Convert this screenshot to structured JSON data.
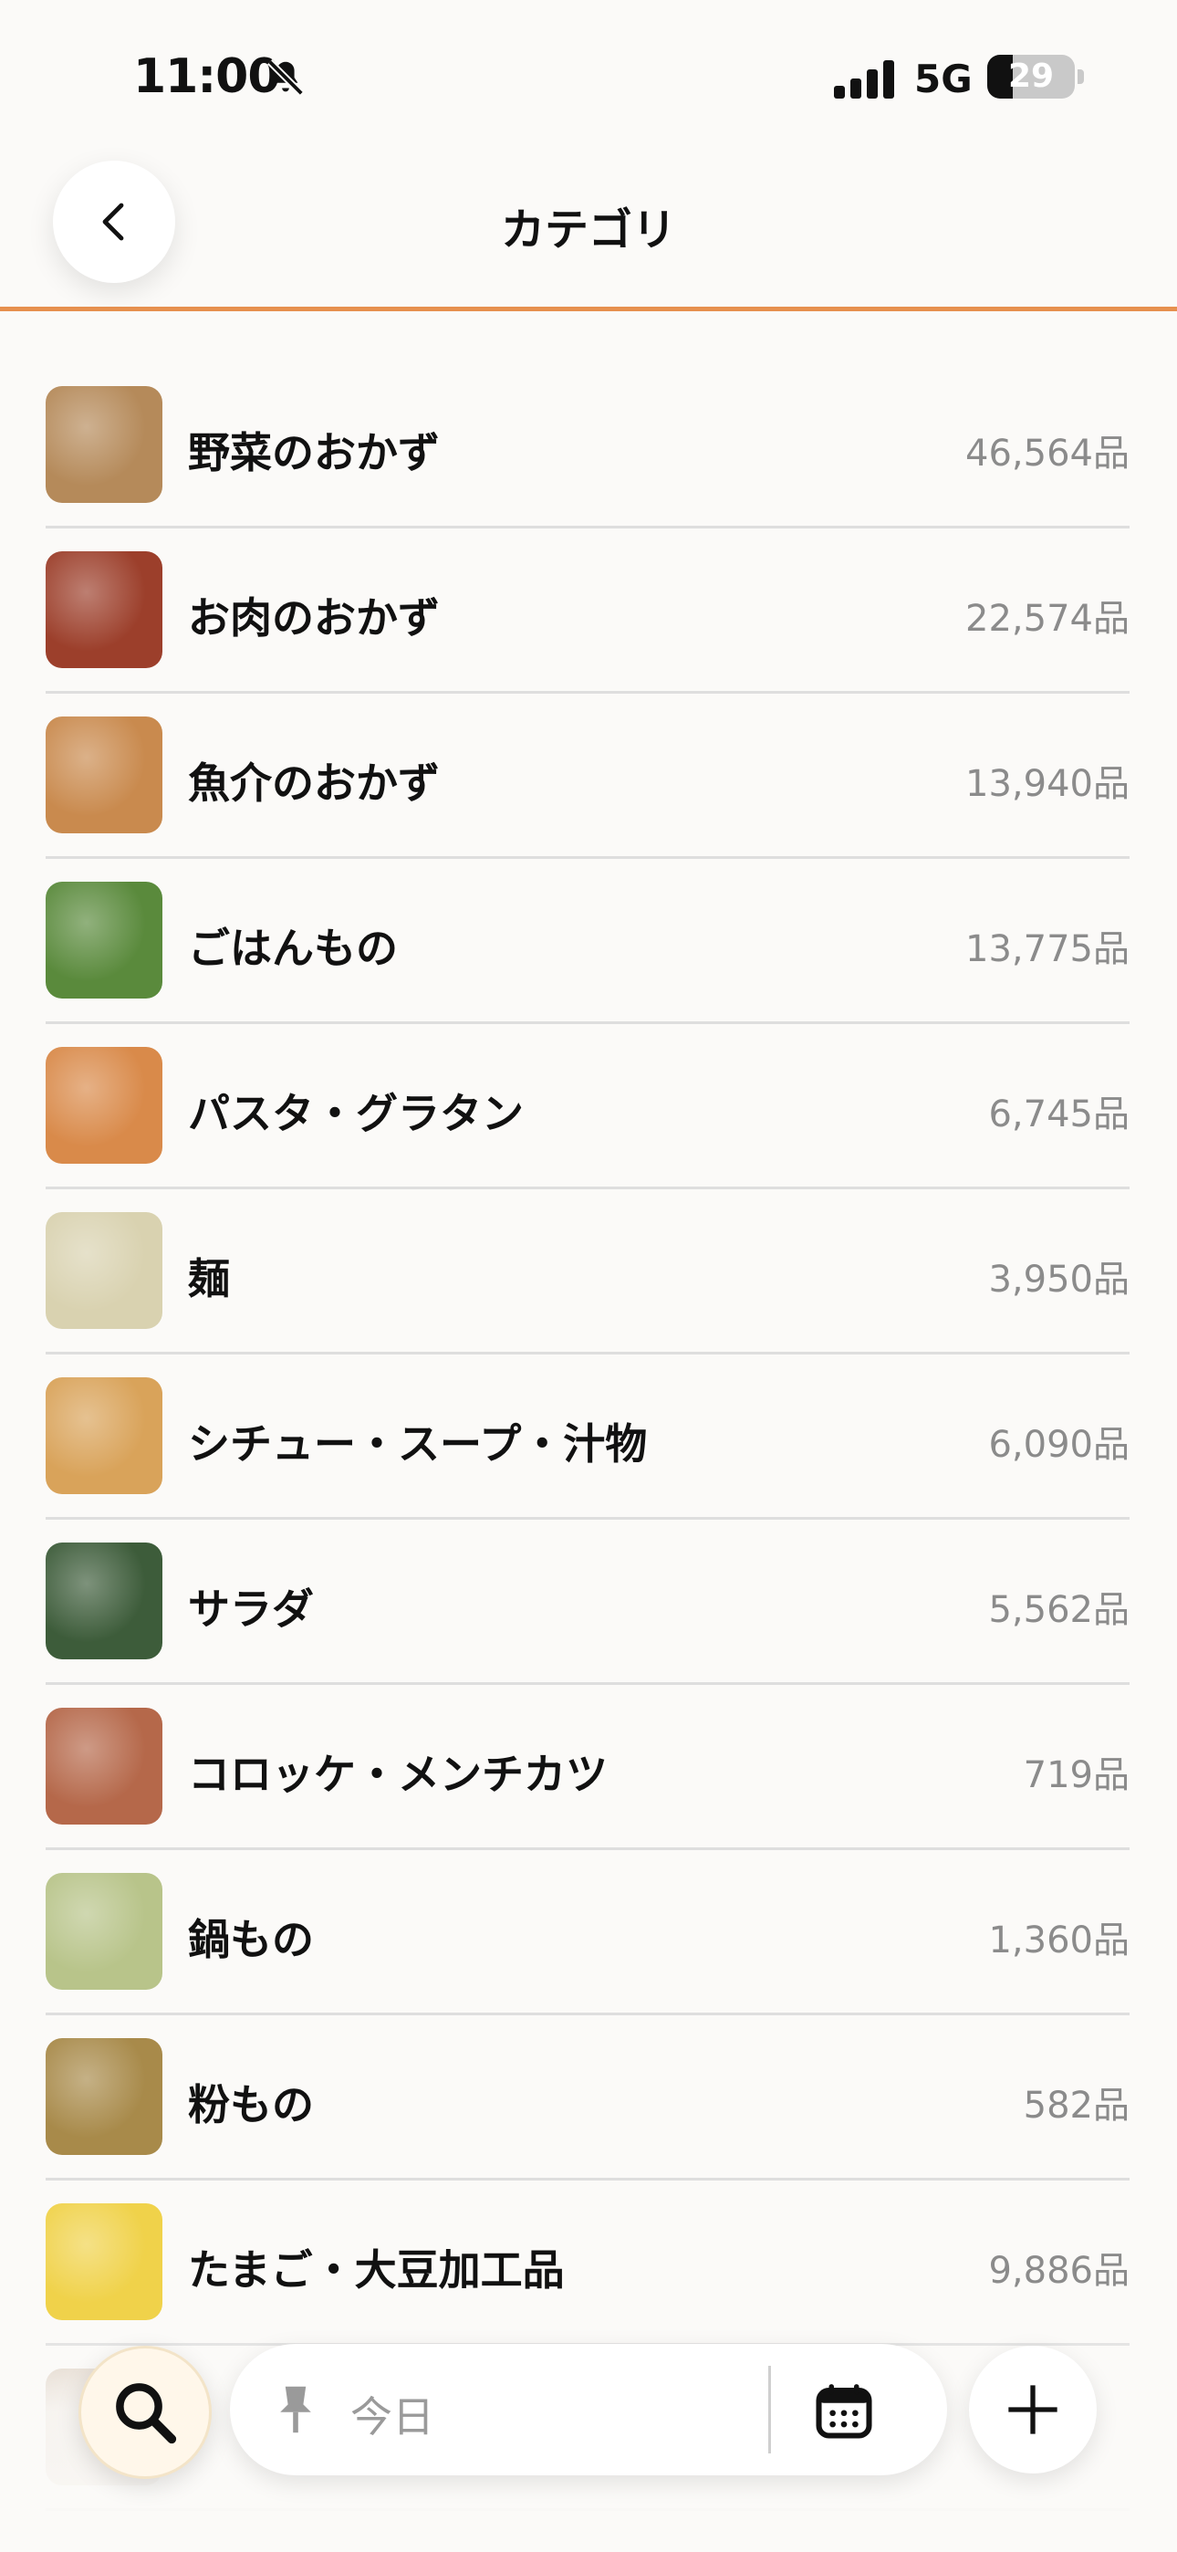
{
  "status_bar": {
    "time": "11:00",
    "network": "5G",
    "battery_level": "29",
    "battery_fraction": 0.29
  },
  "header": {
    "title": "カテゴリ"
  },
  "categories": [
    {
      "label": "野菜のおかず",
      "count": "46,564品",
      "thumb_color": "#b58a5a"
    },
    {
      "label": "お肉のおかず",
      "count": "22,574品",
      "thumb_color": "#9c3f2b"
    },
    {
      "label": "魚介のおかず",
      "count": "13,940品",
      "thumb_color": "#c98a4e"
    },
    {
      "label": "ごはんもの",
      "count": "13,775品",
      "thumb_color": "#5a8a3c"
    },
    {
      "label": "パスタ・グラタン",
      "count": "6,745品",
      "thumb_color": "#d98a4a"
    },
    {
      "label": "麺",
      "count": "3,950品",
      "thumb_color": "#d9d2b0"
    },
    {
      "label": "シチュー・スープ・汁物",
      "count": "6,090品",
      "thumb_color": "#d9a35a"
    },
    {
      "label": "サラダ",
      "count": "5,562品",
      "thumb_color": "#3d5c3a"
    },
    {
      "label": "コロッケ・メンチカツ",
      "count": "719品",
      "thumb_color": "#b5684a"
    },
    {
      "label": "鍋もの",
      "count": "1,360品",
      "thumb_color": "#b8c48a"
    },
    {
      "label": "粉もの",
      "count": "582品",
      "thumb_color": "#a88a4a"
    },
    {
      "label": "たまご・大豆加工品",
      "count": "9,886品",
      "thumb_color": "#f0d24a"
    },
    {
      "label": "",
      "count": "",
      "thumb_color": "#d8c8b8"
    }
  ],
  "bottom_bar": {
    "pill_placeholder": "今日"
  },
  "colors": {
    "accent": "#e6904e",
    "background": "#fbfaf8",
    "count_text": "#8b8b8b"
  },
  "icons": [
    "back-chevron-icon",
    "bell-slash-icon",
    "signal-icon",
    "search-icon",
    "pin-icon",
    "calendar-icon",
    "plus-icon"
  ]
}
